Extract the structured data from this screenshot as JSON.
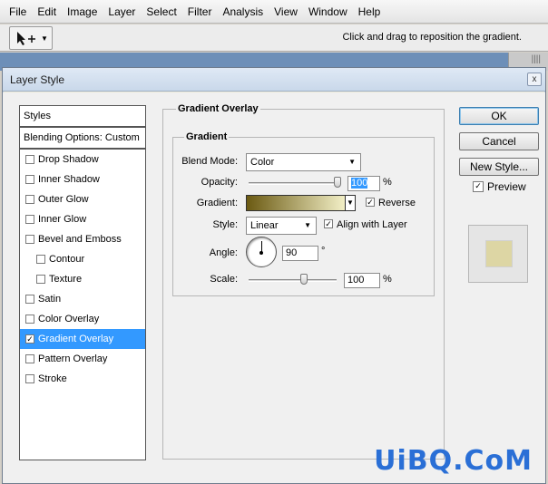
{
  "menu": [
    "File",
    "Edit",
    "Image",
    "Layer",
    "Select",
    "Filter",
    "Analysis",
    "View",
    "Window",
    "Help"
  ],
  "options_bar": {
    "hint": "Click and drag to reposition the gradient."
  },
  "dialog": {
    "title": "Layer Style",
    "close_label": "x",
    "styles_header": "Styles",
    "blending_header": "Blending Options: Custom",
    "style_items": [
      {
        "label": "Drop Shadow",
        "checked": false
      },
      {
        "label": "Inner Shadow",
        "checked": false
      },
      {
        "label": "Outer Glow",
        "checked": false
      },
      {
        "label": "Inner Glow",
        "checked": false
      },
      {
        "label": "Bevel and Emboss",
        "checked": false
      },
      {
        "label": "Contour",
        "checked": false
      },
      {
        "label": "Texture",
        "checked": false
      },
      {
        "label": "Satin",
        "checked": false
      },
      {
        "label": "Color Overlay",
        "checked": false
      },
      {
        "label": "Gradient Overlay",
        "checked": true
      },
      {
        "label": "Pattern Overlay",
        "checked": false
      },
      {
        "label": "Stroke",
        "checked": false
      }
    ],
    "section_title": "Gradient Overlay",
    "group_title": "Gradient",
    "blend_mode_label": "Blend Mode:",
    "blend_mode_value": "Color",
    "opacity_label": "Opacity:",
    "opacity_value": "100",
    "percent": "%",
    "gradient_label": "Gradient:",
    "reverse_label": "Reverse",
    "reverse_checked": true,
    "style_label": "Style:",
    "style_value": "Linear",
    "align_label": "Align with Layer",
    "align_checked": true,
    "angle_label": "Angle:",
    "angle_value": "90",
    "degree": "°",
    "scale_label": "Scale:",
    "scale_value": "100",
    "buttons": {
      "ok": "OK",
      "cancel": "Cancel",
      "new_style": "New Style..."
    },
    "preview_label": "Preview",
    "preview_checked": true,
    "gradient_colors": [
      "#6b5a12",
      "#f2efc6"
    ],
    "preview_color": "#ddd6a4"
  },
  "watermark": "UiBQ.CoM"
}
